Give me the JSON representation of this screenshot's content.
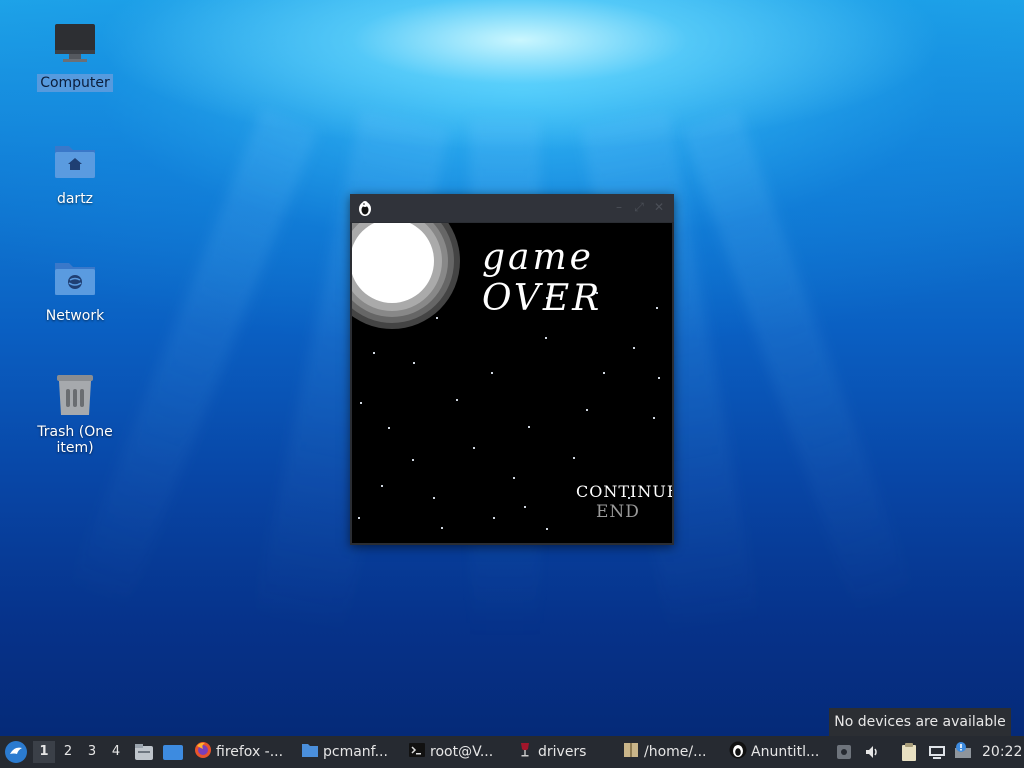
{
  "desktop": {
    "icons": [
      {
        "label": "Computer",
        "icon": "computer-icon",
        "selected": true
      },
      {
        "label": "dartz",
        "icon": "home-folder-icon"
      },
      {
        "label": "Network",
        "icon": "network-folder-icon"
      },
      {
        "label": "Trash (One item)",
        "icon": "trash-icon"
      }
    ]
  },
  "game_window": {
    "title_icon": "penguin-icon",
    "controls": [
      "minimize-icon",
      "maximize-icon",
      "close-icon"
    ],
    "screen": {
      "title": "game OVER",
      "menu": {
        "continue": "CONTINUE",
        "end": "END"
      }
    }
  },
  "tooltip": {
    "text": "No devices are available"
  },
  "taskbar": {
    "start_icon": "lxqt-start-icon",
    "workspaces": [
      "1",
      "2",
      "3",
      "4"
    ],
    "active_workspace": "1",
    "quicklaunch": [
      "file-manager-icon",
      "show-desktop-icon"
    ],
    "tasks": [
      {
        "label": "firefox -...",
        "icon": "firefox-icon"
      },
      {
        "label": "pcmanf...",
        "icon": "folder-icon"
      },
      {
        "label": "root@V...",
        "icon": "terminal-icon"
      },
      {
        "label": "drivers",
        "icon": "wine-icon"
      },
      {
        "label": "/home/...",
        "icon": "archive-icon"
      },
      {
        "label": "Anuntitl...",
        "icon": "penguin-icon"
      }
    ],
    "tray": [
      "screen-icon",
      "volume-icon",
      "clipboard-icon",
      "network-icon",
      "update-notifier-icon"
    ],
    "clock": "20:22"
  }
}
